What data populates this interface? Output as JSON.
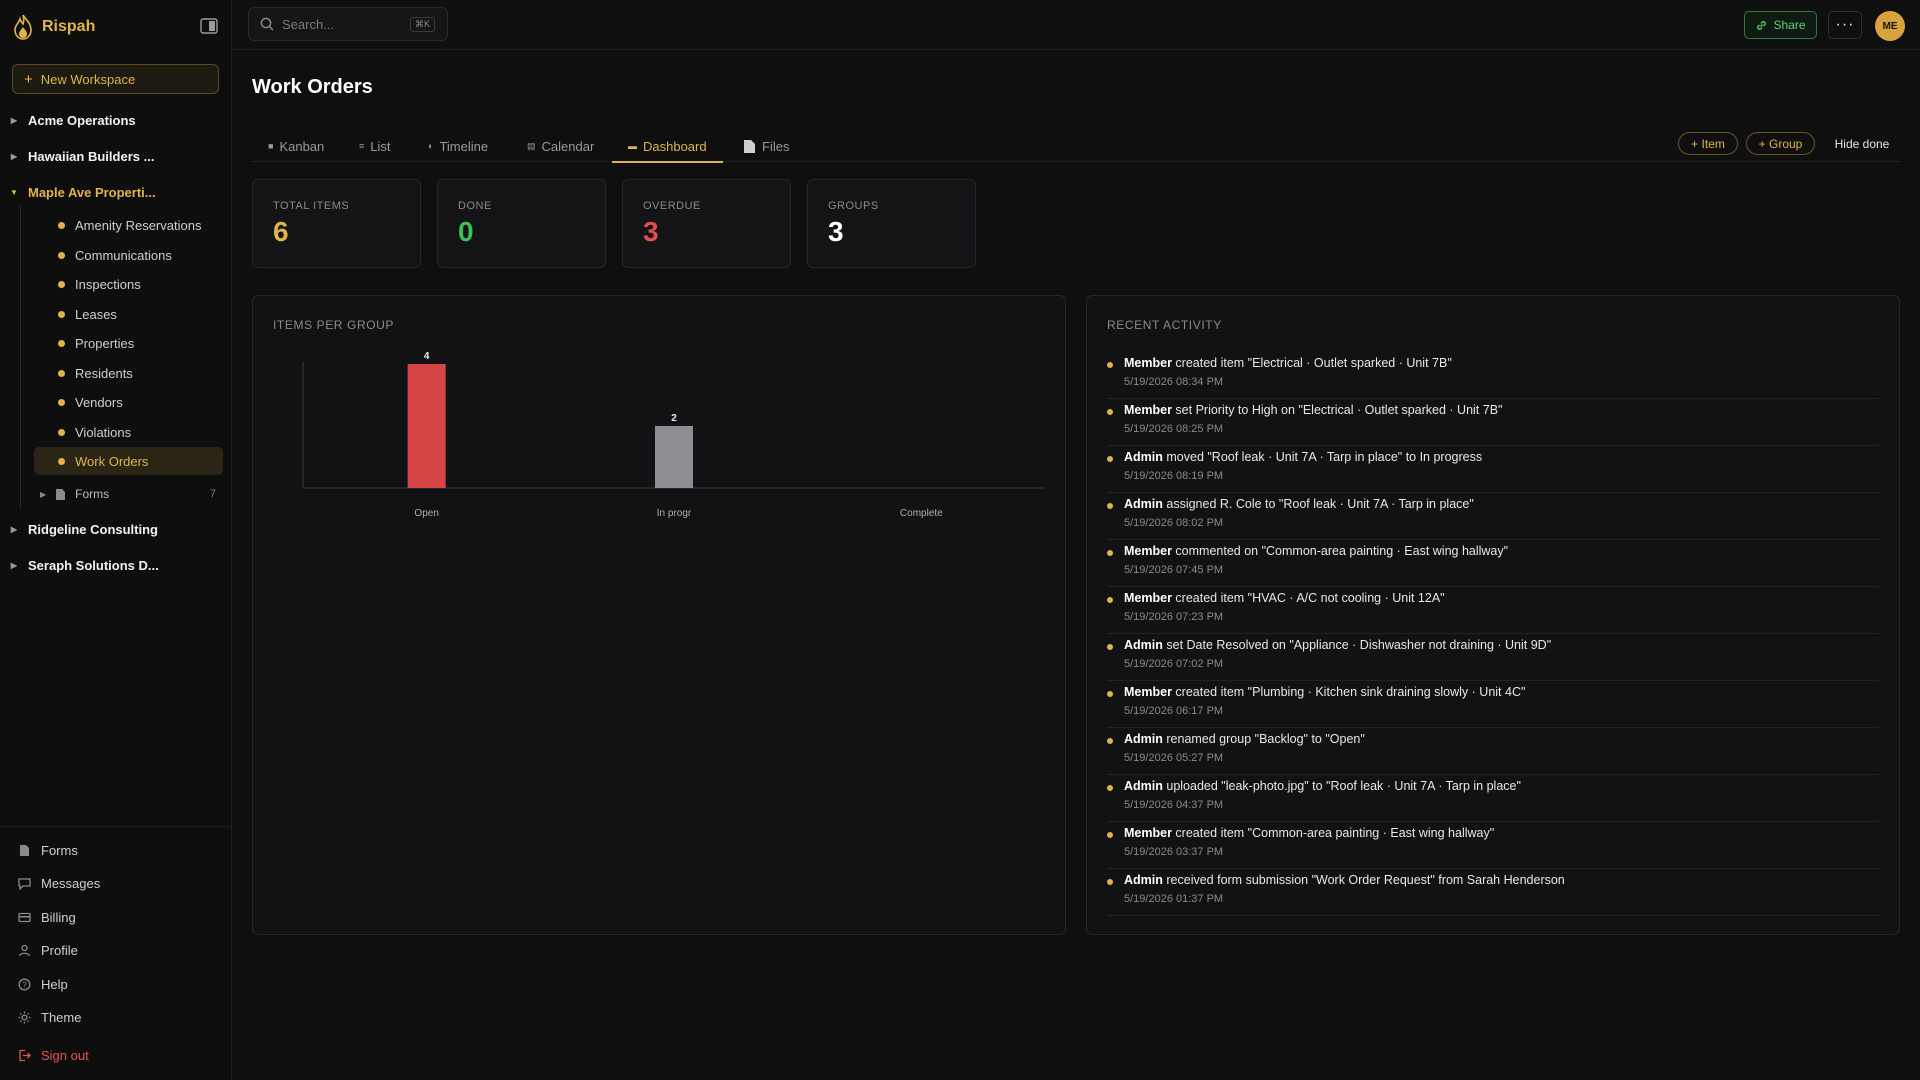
{
  "app": {
    "name": "Rispah"
  },
  "sidebar": {
    "new_workspace_label": "New Workspace",
    "workspaces": [
      {
        "label": "Acme Operations",
        "open": false
      },
      {
        "label": "Hawaiian Builders ...",
        "open": false
      },
      {
        "label": "Maple Ave Properti...",
        "open": true
      },
      {
        "label": "Ridgeline Consulting",
        "open": false
      },
      {
        "label": "Seraph Solutions D...",
        "open": false
      }
    ],
    "boards": [
      {
        "label": "Amenity Reservations"
      },
      {
        "label": "Communications"
      },
      {
        "label": "Inspections"
      },
      {
        "label": "Leases"
      },
      {
        "label": "Properties"
      },
      {
        "label": "Residents"
      },
      {
        "label": "Vendors"
      },
      {
        "label": "Violations"
      },
      {
        "label": "Work Orders",
        "active": true
      }
    ],
    "forms_node": {
      "label": "Forms",
      "count": "7"
    },
    "bottom_links": [
      {
        "label": "Forms",
        "icon": "document-icon"
      },
      {
        "label": "Messages",
        "icon": "chat-icon"
      },
      {
        "label": "Billing",
        "icon": "card-icon"
      },
      {
        "label": "Profile",
        "icon": "user-icon"
      },
      {
        "label": "Help",
        "icon": "help-icon"
      },
      {
        "label": "Theme",
        "icon": "sun-icon"
      },
      {
        "label": "Sign out",
        "icon": "sign-out-icon"
      }
    ]
  },
  "topbar": {
    "search_placeholder": "Search...",
    "search_shortcut": "⌘K",
    "share_label": "Share",
    "more_label": "···",
    "avatar_initials": "ME"
  },
  "page": {
    "title": "Work Orders",
    "tabs": [
      {
        "label": "Kanban",
        "icon": "square-icon"
      },
      {
        "label": "List",
        "icon": "list-icon"
      },
      {
        "label": "Timeline",
        "icon": "half-circle-icon"
      },
      {
        "label": "Calendar",
        "icon": "calendar-icon"
      },
      {
        "label": "Dashboard",
        "icon": "dash-icon",
        "active": true
      },
      {
        "label": "Files",
        "icon": "file-icon"
      }
    ],
    "actions": {
      "add_item": "+ Item",
      "add_group": "+ Group",
      "hide_done": "Hide done"
    }
  },
  "stats": [
    {
      "label": "TOTAL ITEMS",
      "value": "6",
      "color": "#e0b44a"
    },
    {
      "label": "DONE",
      "value": "0",
      "color": "#3fbf5a"
    },
    {
      "label": "OVERDUE",
      "value": "3",
      "color": "#e24d4d"
    },
    {
      "label": "GROUPS",
      "value": "3",
      "color": "#ffffff"
    }
  ],
  "chart_title": "ITEMS PER GROUP",
  "chart_data": {
    "type": "bar",
    "categories": [
      "Open",
      "In progr",
      "Complete"
    ],
    "values": [
      4,
      2,
      0
    ],
    "data_labels": [
      "4",
      "2",
      ""
    ],
    "colors": [
      "#d64545",
      "#8e8e92",
      "#8e8e92"
    ],
    "ylim": [
      0,
      4
    ],
    "grid": false
  },
  "activity": {
    "title": "RECENT ACTIVITY",
    "items": [
      {
        "actor": "Member",
        "text": "created item \"Electrical · Outlet sparked · Unit 7B\"",
        "time": "5/19/2026 08:34 PM"
      },
      {
        "actor": "Member",
        "text": "set Priority to High on \"Electrical · Outlet sparked · Unit 7B\"",
        "time": "5/19/2026 08:25 PM"
      },
      {
        "actor": "Admin",
        "text": "moved \"Roof leak · Unit 7A · Tarp in place\" to In progress",
        "time": "5/19/2026 08:19 PM"
      },
      {
        "actor": "Admin",
        "text": "assigned R. Cole to \"Roof leak · Unit 7A · Tarp in place\"",
        "time": "5/19/2026 08:02 PM"
      },
      {
        "actor": "Member",
        "text": "commented on \"Common-area painting · East wing hallway\"",
        "time": "5/19/2026 07:45 PM"
      },
      {
        "actor": "Member",
        "text": "created item \"HVAC · A/C not cooling · Unit 12A\"",
        "time": "5/19/2026 07:23 PM"
      },
      {
        "actor": "Admin",
        "text": "set Date Resolved on \"Appliance · Dishwasher not draining · Unit 9D\"",
        "time": "5/19/2026 07:02 PM"
      },
      {
        "actor": "Member",
        "text": "created item \"Plumbing · Kitchen sink draining slowly · Unit 4C\"",
        "time": "5/19/2026 06:17 PM"
      },
      {
        "actor": "Admin",
        "text": "renamed group \"Backlog\" to \"Open\"",
        "time": "5/19/2026 05:27 PM"
      },
      {
        "actor": "Admin",
        "text": "uploaded \"leak-photo.jpg\" to \"Roof leak · Unit 7A · Tarp in place\"",
        "time": "5/19/2026 04:37 PM"
      },
      {
        "actor": "Member",
        "text": "created item \"Common-area painting · East wing hallway\"",
        "time": "5/19/2026 03:37 PM"
      },
      {
        "actor": "Admin",
        "text": "received form submission \"Work Order Request\" from Sarah Henderson",
        "time": "5/19/2026 01:37 PM"
      }
    ]
  }
}
